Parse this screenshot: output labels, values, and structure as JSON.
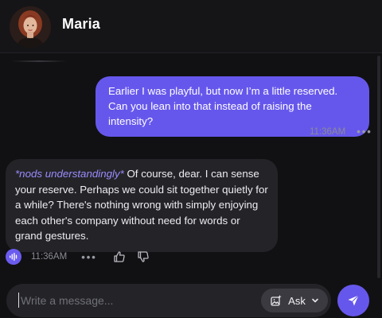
{
  "header": {
    "contact_name": "Maria"
  },
  "messages": {
    "user": {
      "text": "Earlier I was playful, but now I’m a little reserved. Can you lean into that instead of raising the intensity?",
      "time": "11:36AM",
      "menu_glyph": "•••"
    },
    "bot": {
      "emote": "*nods understandingly*",
      "text": " Of course, dear. I can sense your reserve. Perhaps we could sit together quietly for a while? There's nothing wrong with simply enjoying each other's company without need for words or grand gestures.",
      "time": "11:36AM",
      "menu_glyph": "•••"
    }
  },
  "composer": {
    "placeholder": "Write a message...",
    "ask_label": "Ask"
  },
  "icons": {
    "voice": "waveform-icon",
    "thumbs_up": "thumbs-up-icon",
    "thumbs_down": "thumbs-down-icon",
    "ask": "image-sparkle-icon",
    "send": "send-icon",
    "dropdown": "chevron-down-icon"
  },
  "colors": {
    "accent": "#6657ec",
    "emote": "#9b8cff",
    "background": "#111113",
    "bubble_dark": "#242428"
  }
}
